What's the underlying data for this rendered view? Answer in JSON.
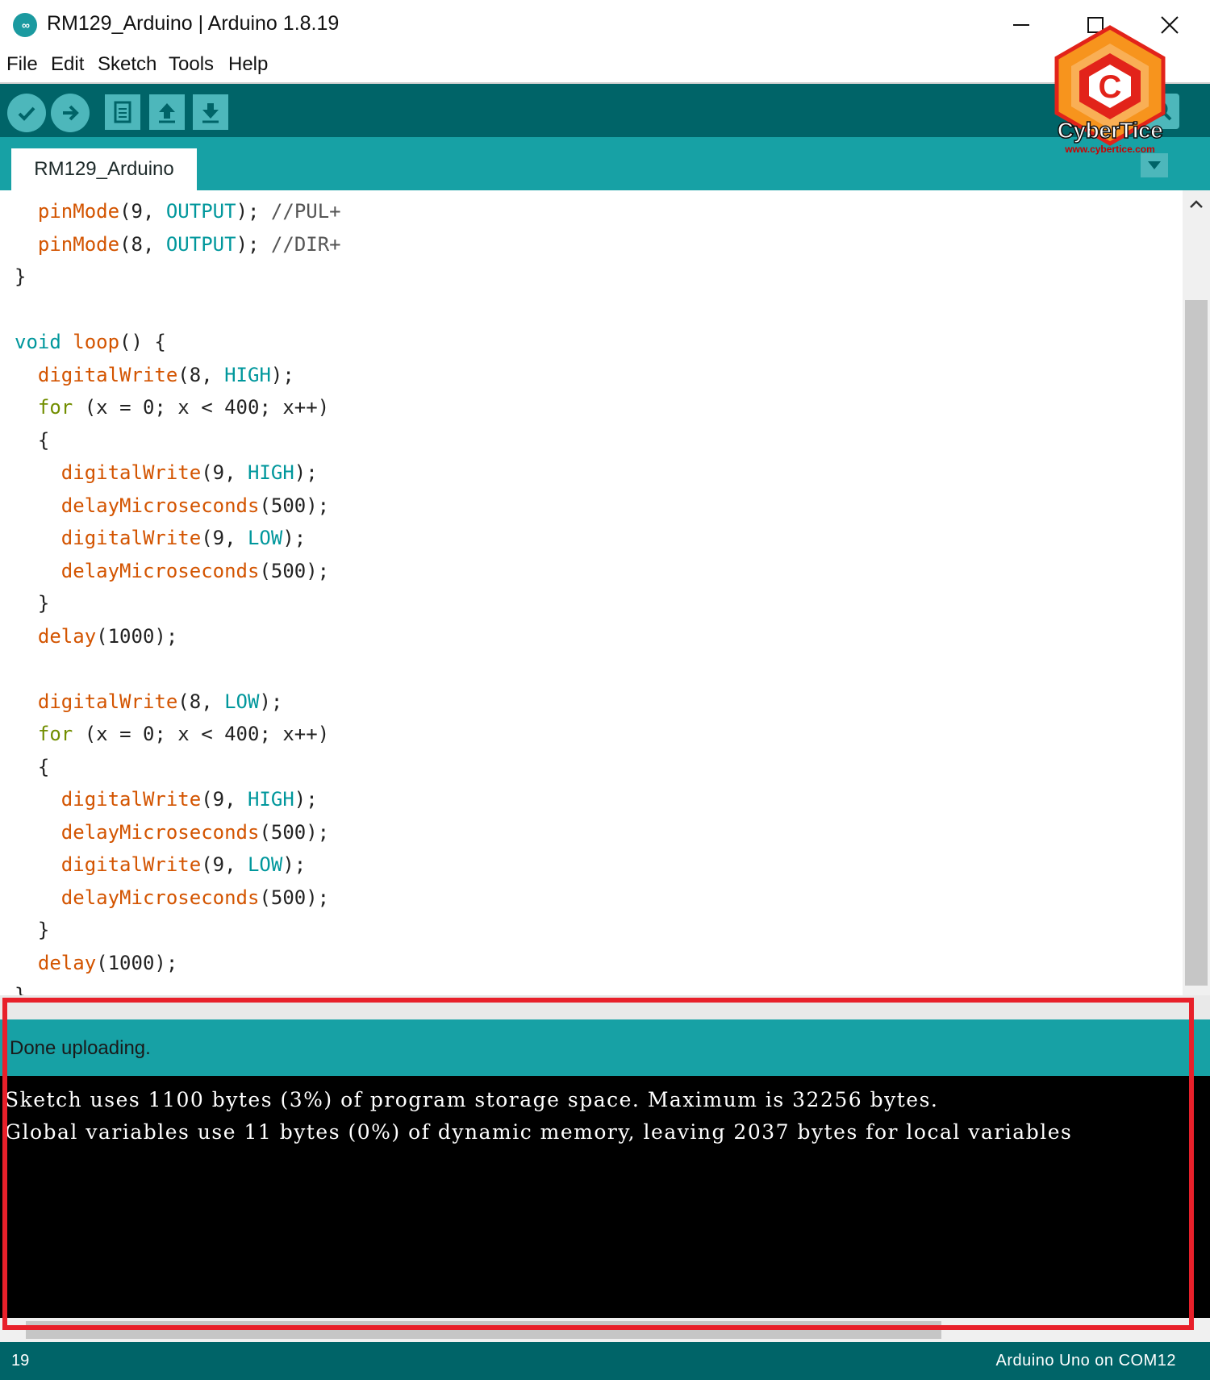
{
  "window": {
    "title": "RM129_Arduino | Arduino 1.8.19",
    "app_icon": "arduino-infinity-icon",
    "controls": [
      "minimize-icon",
      "maximize-icon",
      "close-icon"
    ]
  },
  "menu": {
    "items": [
      "File",
      "Edit",
      "Sketch",
      "Tools",
      "Help"
    ]
  },
  "toolbar": {
    "buttons": [
      "verify-checkmark-icon",
      "upload-arrow-icon",
      "new-sketch-icon",
      "open-sketch-icon",
      "save-sketch-icon"
    ],
    "serial_monitor": "magnifier-icon"
  },
  "tabs": {
    "active": "RM129_Arduino",
    "menu_icon": "triangle-down-icon"
  },
  "watermark": {
    "name": "CyberTice",
    "url": "www.cybertice.com",
    "colors": {
      "hex_orange": "#f7941d",
      "hex_red": "#e2231a"
    }
  },
  "editor": {
    "lines": [
      "  pinMode(9, OUTPUT); //PUL+",
      "  pinMode(8, OUTPUT); //DIR+",
      "}",
      "",
      "void loop() {",
      "  digitalWrite(8, HIGH);",
      "  for (x = 0; x < 400; x++)",
      "  {",
      "    digitalWrite(9, HIGH);",
      "    delayMicroseconds(500);",
      "    digitalWrite(9, LOW);",
      "    delayMicroseconds(500);",
      "  }",
      "  delay(1000);",
      "",
      "  digitalWrite(8, LOW);",
      "  for (x = 0; x < 400; x++)",
      "  {",
      "    digitalWrite(9, HIGH);",
      "    delayMicroseconds(500);",
      "    digitalWrite(9, LOW);",
      "    delayMicroseconds(500);",
      "  }",
      "  delay(1000);",
      "}"
    ]
  },
  "status": {
    "message": "Done uploading."
  },
  "console": {
    "lines": [
      "Sketch uses 1100 bytes (3%) of program storage space. Maximum is 32256 bytes.",
      "Global variables use 11 bytes (0%) of dynamic memory, leaving 2037 bytes for local variables"
    ]
  },
  "footer": {
    "line_number": "19",
    "board": "Arduino Uno on COM12"
  },
  "colors": {
    "toolbar_bg": "#006468",
    "tabbar_bg": "#17a1a5",
    "button_bg": "#4db7bb",
    "highlight_border": "#e8202a",
    "keyword_function": "#d35400",
    "keyword_constant": "#00979c"
  }
}
